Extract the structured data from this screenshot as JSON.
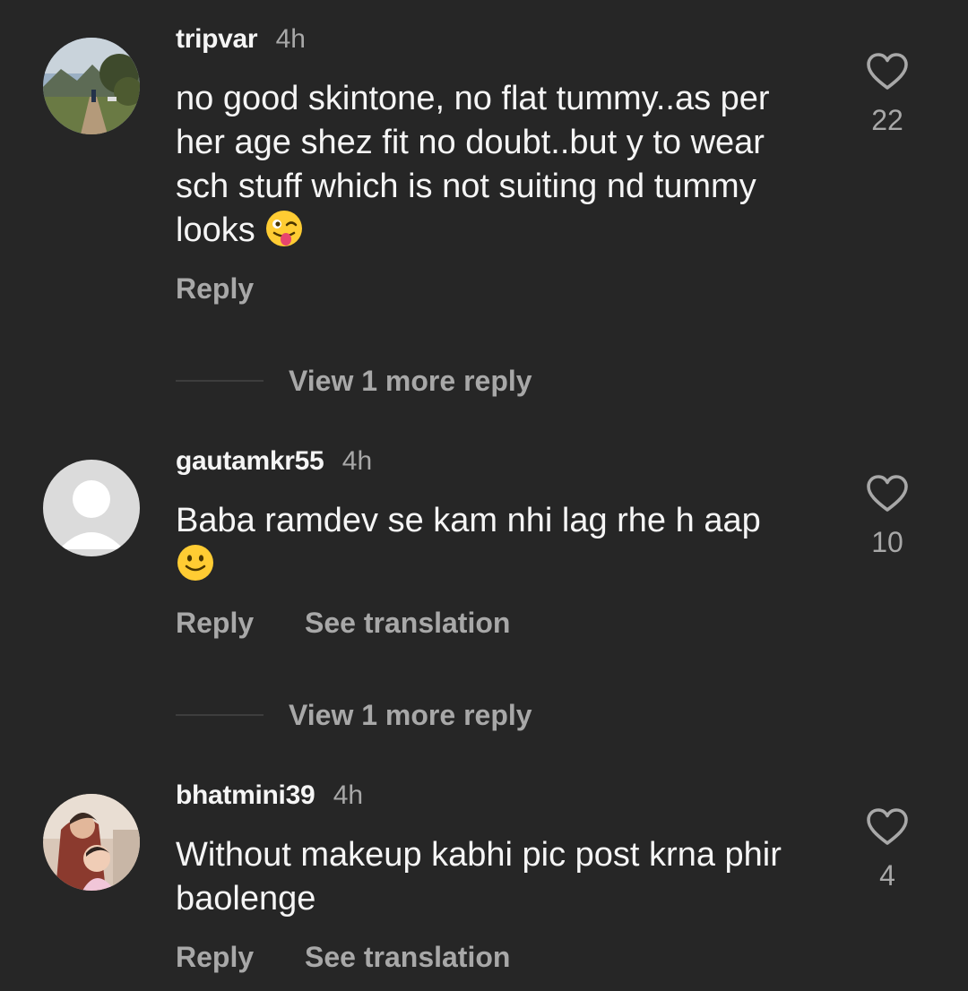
{
  "comments": [
    {
      "username": "tripvar",
      "time": "4h",
      "text": "no good skintone, no flat tummy..as per her age shez fit no doubt..but y to wear sch stuff which is not suiting nd tummy looks",
      "emoji": "winking-face-with-tongue",
      "likes": "22",
      "reply_label": "Reply",
      "more_replies": "View 1 more reply"
    },
    {
      "username": "gautamkr55",
      "time": "4h",
      "text": "Baba ramdev se kam nhi lag rhe h aap",
      "emoji": "slightly-smiling-face",
      "likes": "10",
      "reply_label": "Reply",
      "translate_label": "See translation",
      "more_replies": "View 1 more reply"
    },
    {
      "username": "bhatmini39",
      "time": "4h",
      "text": "Without makeup kabhi pic post krna phir baolenge",
      "likes": "4",
      "reply_label": "Reply",
      "translate_label": "See translation"
    }
  ],
  "colors": {
    "background": "#262626",
    "primary_text": "#f5f5f5",
    "secondary_text": "#a8a8a8"
  }
}
